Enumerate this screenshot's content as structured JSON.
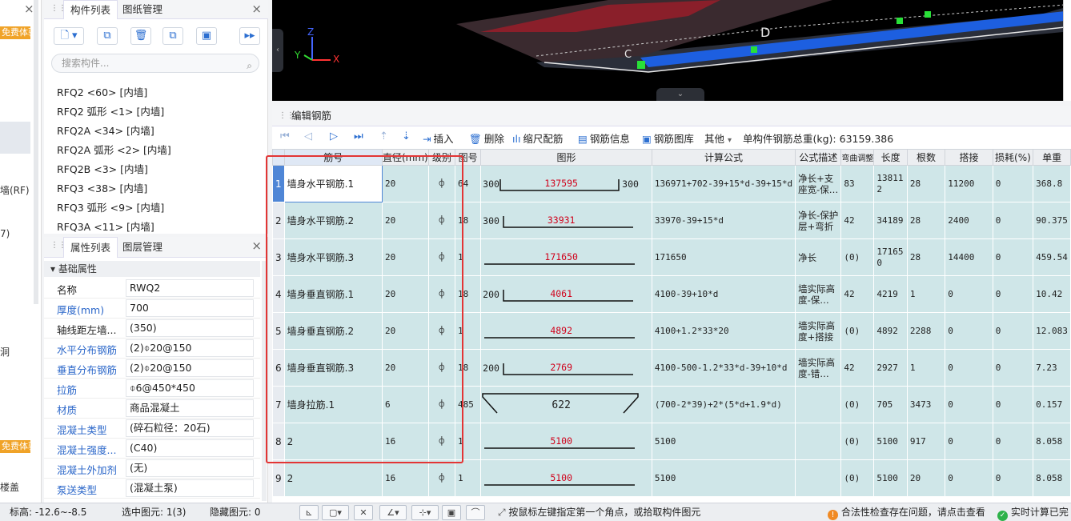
{
  "left_strip": {
    "badge1": "免费体验",
    "badge2": "免费体验",
    "t1": "墙(RF)",
    "t2": "7)",
    "t3": "洞",
    "t4": "楼盖"
  },
  "component_panel": {
    "tabs": [
      "构件列表",
      "图纸管理"
    ],
    "search_placeholder": "搜索构件...",
    "items": [
      "RFQ2 <60> [内墙]",
      "RFQ2 弧形 <1> [内墙]",
      "RFQ2A <34> [内墙]",
      "RFQ2A 弧形 <2> [内墙]",
      "RFQ2B <3> [内墙]",
      "RFQ3 <38> [内墙]",
      "RFQ3 弧形 <9> [内墙]",
      "RFQ3A <11> [内墙]"
    ]
  },
  "property_panel": {
    "tabs": [
      "属性列表",
      "图层管理"
    ],
    "section": "基础属性",
    "rows": [
      {
        "name": "名称",
        "value": "RWQ2"
      },
      {
        "name": "厚度(mm)",
        "value": "700"
      },
      {
        "name": "轴线距左墙...",
        "value": "(350)"
      },
      {
        "name": "水平分布钢筋",
        "value": "(2)⌽20@150"
      },
      {
        "name": "垂直分布钢筋",
        "value": "(2)⌽20@150"
      },
      {
        "name": "拉筋",
        "value": "⌽6@450*450"
      },
      {
        "name": "材质",
        "value": "商品混凝土"
      },
      {
        "name": "混凝土类型",
        "value": "(碎石粒径：20石)"
      },
      {
        "name": "混凝土强度...",
        "value": "(C40)"
      },
      {
        "name": "混凝土外加剂",
        "value": "(无)"
      },
      {
        "name": "泵送类型",
        "value": "(混凝土泵)"
      }
    ]
  },
  "view3d": {
    "axis_z": "Z",
    "axis_y": "Y",
    "axis_x": "X",
    "grid_d": "D",
    "grid_c": "C"
  },
  "editor": {
    "title": "编辑钢筋",
    "toolbar": {
      "insert": "插入",
      "delete": "删除",
      "scale": "缩尺配筋",
      "info": "钢筋信息",
      "library": "钢筋图库",
      "other": "其他",
      "total": "单构件钢筋总重(kg): 63159.386"
    },
    "columns": [
      "筋号",
      "直径(mm)",
      "级别",
      "图号",
      "图形",
      "计算公式",
      "公式描述",
      "弯曲调整",
      "长度",
      "根数",
      "搭接",
      "损耗(%)",
      "单重"
    ],
    "rows": [
      {
        "n": "1",
        "name": "墙身水平钢筋.1",
        "dia": "20",
        "grade": "⌽",
        "fig": "64",
        "shape_type": "c",
        "left": "300",
        "mid": "137595",
        "right": "300",
        "formula": "136971+702-39+15*d-39+15*d",
        "desc": "净长+支座宽-保…",
        "bend": "83",
        "length": "138112",
        "count": "28",
        "lap": "11200",
        "loss": "0",
        "unit": "368.8"
      },
      {
        "n": "2",
        "name": "墙身水平钢筋.2",
        "dia": "20",
        "grade": "⌽",
        "fig": "18",
        "shape_type": "l",
        "left": "300",
        "mid": "33931",
        "right": "",
        "formula": "33970-39+15*d",
        "desc": "净长-保护层+弯折",
        "bend": "42",
        "length": "34189",
        "count": "28",
        "lap": "2400",
        "loss": "0",
        "unit": "90.375"
      },
      {
        "n": "3",
        "name": "墙身水平钢筋.3",
        "dia": "20",
        "grade": "⌽",
        "fig": "1",
        "shape_type": "s",
        "left": "",
        "mid": "171650",
        "right": "",
        "formula": "171650",
        "desc": "净长",
        "bend": "(0)",
        "length": "171650",
        "count": "28",
        "lap": "14400",
        "loss": "0",
        "unit": "459.54"
      },
      {
        "n": "4",
        "name": "墙身垂直钢筋.1",
        "dia": "20",
        "grade": "⌽",
        "fig": "18",
        "shape_type": "l",
        "left": "200",
        "mid": "4061",
        "right": "",
        "formula": "4100-39+10*d",
        "desc": "墙实际高度-保…",
        "bend": "42",
        "length": "4219",
        "count": "1",
        "lap": "0",
        "loss": "0",
        "unit": "10.42"
      },
      {
        "n": "5",
        "name": "墙身垂直钢筋.2",
        "dia": "20",
        "grade": "⌽",
        "fig": "1",
        "shape_type": "s",
        "left": "",
        "mid": "4892",
        "right": "",
        "formula": "4100+1.2*33*20",
        "desc": "墙实际高度+搭接",
        "bend": "(0)",
        "length": "4892",
        "count": "2288",
        "lap": "0",
        "loss": "0",
        "unit": "12.083"
      },
      {
        "n": "6",
        "name": "墙身垂直钢筋.3",
        "dia": "20",
        "grade": "⌽",
        "fig": "18",
        "shape_type": "l",
        "left": "200",
        "mid": "2769",
        "right": "",
        "formula": "4100-500-1.2*33*d-39+10*d",
        "desc": "墙实际高度-错…",
        "bend": "42",
        "length": "2927",
        "count": "1",
        "lap": "0",
        "loss": "0",
        "unit": "7.23"
      },
      {
        "n": "7",
        "name": "墙身拉筋.1",
        "dia": "6",
        "grade": "⌽",
        "fig": "485",
        "shape_type": "tie",
        "left": "",
        "mid": "622",
        "right": "",
        "formula": "(700-2*39)+2*(5*d+1.9*d)",
        "desc": "",
        "bend": "(0)",
        "length": "705",
        "count": "3473",
        "lap": "0",
        "loss": "0",
        "unit": "0.157"
      },
      {
        "n": "8",
        "name": "2",
        "dia": "16",
        "grade": "⌽",
        "fig": "1",
        "shape_type": "s",
        "left": "",
        "mid": "5100",
        "right": "",
        "formula": "5100",
        "desc": "",
        "bend": "(0)",
        "length": "5100",
        "count": "917",
        "lap": "0",
        "loss": "0",
        "unit": "8.058"
      },
      {
        "n": "9",
        "name": "2",
        "dia": "16",
        "grade": "⌽",
        "fig": "1",
        "shape_type": "s",
        "left": "",
        "mid": "5100",
        "right": "",
        "formula": "5100",
        "desc": "",
        "bend": "(0)",
        "length": "5100",
        "count": "20",
        "lap": "0",
        "loss": "0",
        "unit": "8.058"
      }
    ]
  },
  "statusbar": {
    "elevation": "标高:  -12.6~-8.5",
    "selected": "选中图元: 1(3)",
    "hidden": "隐藏图元: 0",
    "hint": "按鼠标左键指定第一个角点，或拾取构件图元",
    "warn": "合法性检查存在问题，请点击查看",
    "realtime": "实时计算已完"
  },
  "colors": {
    "accent": "#2c6fd1",
    "row_bg": "#cfe6e8",
    "highlight_box": "#e33535",
    "shape_label": "#d0021b",
    "badge": "#f0a328"
  }
}
